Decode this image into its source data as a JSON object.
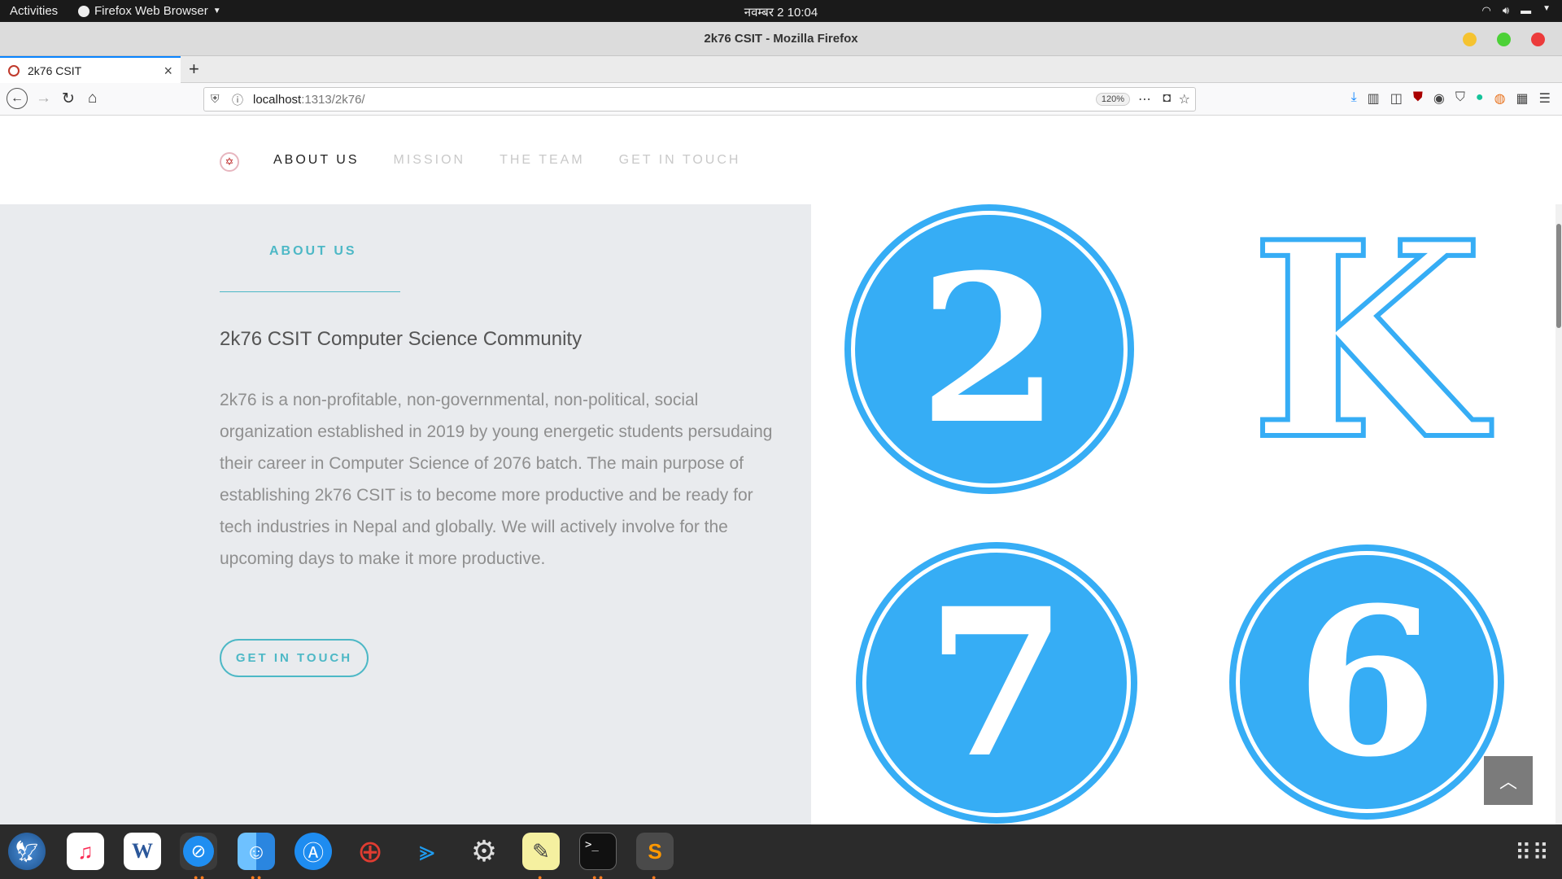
{
  "topbar": {
    "activities": "Activities",
    "app_name": "Firefox Web Browser",
    "clock": "नवम्बर 2  10:04"
  },
  "window": {
    "title": "2k76 CSIT - Mozilla Firefox",
    "buttons": {
      "minimize_color": "#f5c330",
      "maximize_color": "#4cd137",
      "close_color": "#ec3b3b"
    }
  },
  "tab": {
    "title": "2k76 CSIT",
    "new_tab": "+"
  },
  "urlbar": {
    "host": "localhost",
    "path": ":1313/2k76/",
    "zoom": "120%"
  },
  "site": {
    "menu": [
      {
        "label": "ABOUT US",
        "active": true
      },
      {
        "label": "MISSION",
        "active": false
      },
      {
        "label": "THE TEAM",
        "active": false
      },
      {
        "label": "GET IN TOUCH",
        "active": false
      }
    ],
    "about": {
      "eyebrow": "ABOUT US",
      "heading": "2k76 CSIT Computer Science Community",
      "body": "2k76 is a non-profitable, non-governmental, non-political, social organization established in 2019 by young energetic students persudaing their career in Computer Science of 2076 batch. The main purpose of establishing 2k76 CSIT is to become more productive and be ready for tech industries in Nepal and globally. We will actively involve for the upcoming days to make it more productive.",
      "cta": "GET IN TOUCH"
    },
    "image_tiles": [
      "2",
      "K",
      "7",
      "6"
    ],
    "accent": "#4db8c6",
    "badge_color": "#36adf5"
  },
  "dock": {
    "apps": [
      "eagle-icon",
      "music-icon",
      "word-icon",
      "safari-icon",
      "finder-icon",
      "app-store-icon",
      "help-icon",
      "vscode-icon",
      "settings-icon",
      "notes-icon",
      "terminal-icon",
      "sublime-icon"
    ]
  }
}
